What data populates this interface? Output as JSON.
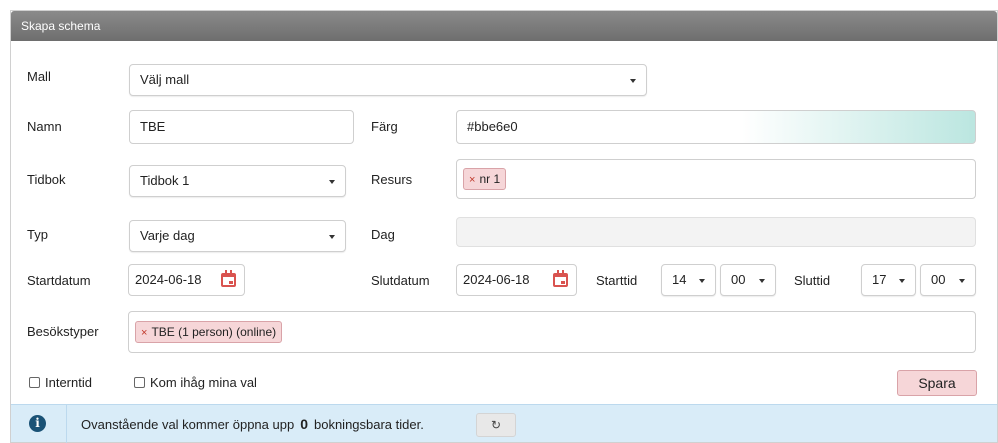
{
  "panel": {
    "title": "Skapa schema"
  },
  "labels": {
    "mall": "Mall",
    "namn": "Namn",
    "farg": "Färg",
    "tidbok": "Tidbok",
    "resurs": "Resurs",
    "typ": "Typ",
    "dag": "Dag",
    "startdatum": "Startdatum",
    "slutdatum": "Slutdatum",
    "starttid": "Starttid",
    "sluttid": "Sluttid",
    "besokstyper": "Besökstyper"
  },
  "fields": {
    "mall": "Välj mall",
    "namn": "TBE",
    "farg": "#bbe6e0",
    "tidbok": "Tidbok 1",
    "resurs_tag": "nr 1",
    "typ": "Varje dag",
    "dag": "",
    "startdatum": "2024-06-18",
    "slutdatum": "2024-06-18",
    "starttid_h": "14",
    "starttid_m": "00",
    "sluttid_h": "17",
    "sluttid_m": "00",
    "besokstyper_tag": "TBE (1 person) (online)"
  },
  "colors": {
    "farg_swatch": "#bbe6e0",
    "tag_bg": "#f6d6d8",
    "info_bg": "#d9ecf8"
  },
  "checkboxes": {
    "interntid": "Interntid",
    "kom_ihag": "Kom ihåg mina val"
  },
  "actions": {
    "spara": "Spara",
    "refresh_icon": "↻",
    "tag_remove": "×"
  },
  "info": {
    "icon": "i",
    "text_before": "Ovanstående val kommer öppna upp",
    "count": "0",
    "text_after": "bokningsbara tider."
  }
}
